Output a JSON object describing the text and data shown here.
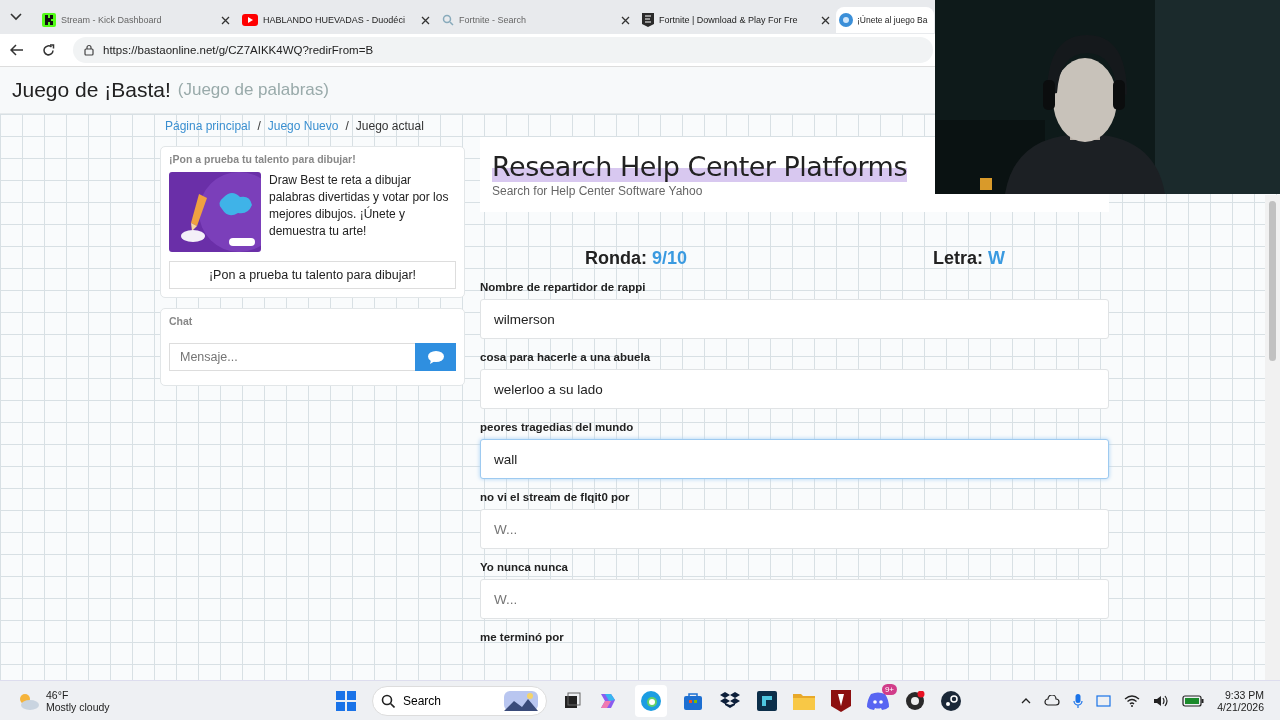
{
  "browser": {
    "tabs": [
      {
        "title": "Stream - Kick Dashboard",
        "kind": "kick",
        "selected": false
      },
      {
        "title": "HABLANDO HUEVADAS - Duodéci",
        "kind": "video",
        "selected": false
      },
      {
        "title": "Fortnite - Search",
        "kind": "search",
        "selected": false
      },
      {
        "title": "Fortnite | Download & Play For Fre",
        "kind": "shield",
        "selected": false
      },
      {
        "title": "¡Únete al juego Ba",
        "kind": "globe",
        "selected": true
      }
    ],
    "address": "https://bastaonline.net/g/CZ7AIKK4WQ?redirFrom=B"
  },
  "page": {
    "title": "Juego de ¡Basta!",
    "subtitle": "(Juego de palabras)",
    "breadcrumb_separator": "/",
    "breadcrumbs": [
      {
        "label": "Página principal",
        "kind": "link"
      },
      {
        "label": "Juego Nuevo",
        "kind": "link"
      },
      {
        "label": "Juego actual",
        "kind": "current"
      }
    ],
    "promo": {
      "heading": "¡Pon a prueba tu talento para dibujar!",
      "text": "Draw Best te reta a dibujar palabras divertidas y votar por los mejores dibujos. ¡Únete y demuestra tu arte!",
      "button": "¡Pon a prueba tu talento para dibujar!"
    },
    "chat": {
      "heading": "Chat",
      "placeholder": "Mensaje..."
    },
    "ad": {
      "title": "Research Help Center Platforms",
      "subtitle": "Search for Help Center Software Yahoo"
    },
    "round_label": "Ronda:",
    "round": "9/10",
    "letter_label": "Letra:",
    "letter": "W",
    "fields": [
      {
        "label": "Nombre de repartidor de rappi",
        "value": "wilmerson",
        "focused": false
      },
      {
        "label": "cosa para hacerle a una abuela",
        "value": "welerloo a su lado",
        "focused": false
      },
      {
        "label": "peores tragedias del mundo",
        "value": "wall",
        "focused": true
      },
      {
        "label": "no vi el stream de flqit0 por",
        "placeholder": "W...",
        "focused": false
      },
      {
        "label": "Yo nunca nunca",
        "placeholder": "W...",
        "focused": false
      },
      {
        "label": "me terminó por"
      }
    ]
  },
  "taskbar": {
    "temperature": "46°F",
    "weather": "Mostly cloudy",
    "search": "Search",
    "chat_badge": "9+",
    "time": "9:33 PM",
    "date": "4/21/2026"
  }
}
